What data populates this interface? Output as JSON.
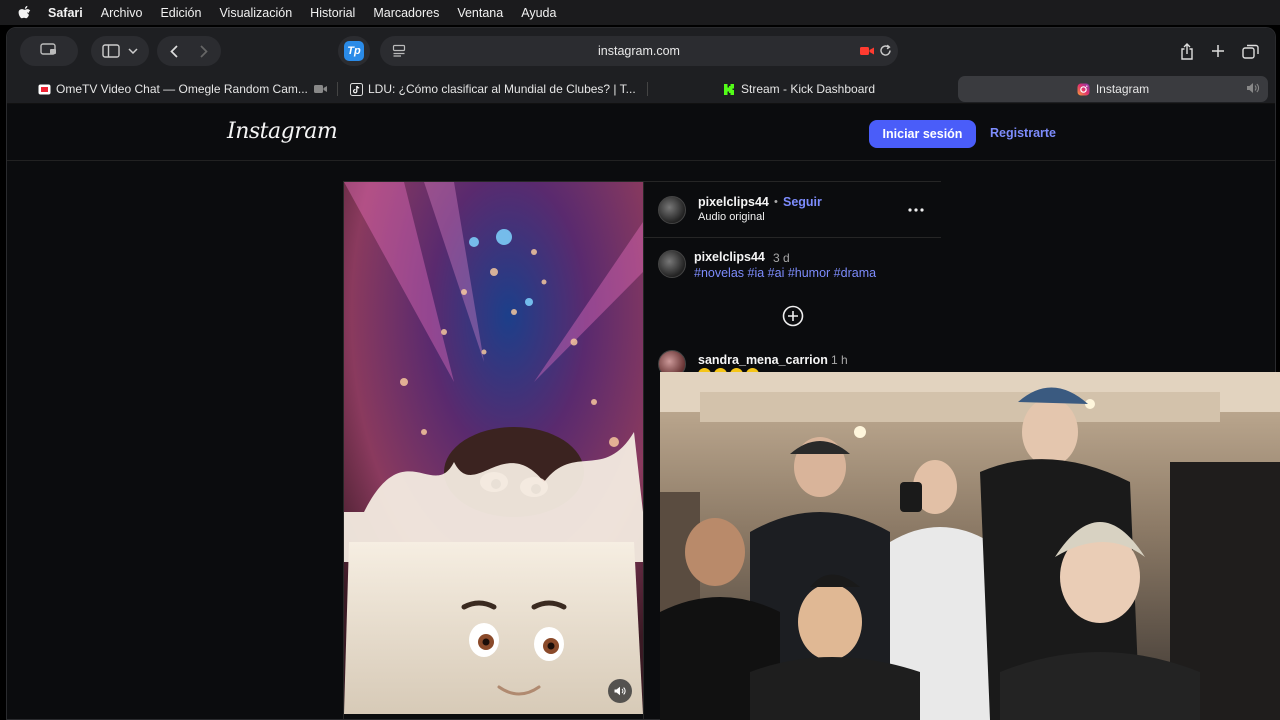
{
  "menubar": {
    "app": "Safari",
    "items": [
      "Archivo",
      "Edición",
      "Visualización",
      "Historial",
      "Marcadores",
      "Ventana",
      "Ayuda"
    ]
  },
  "toolbar": {
    "url": "instagram.com",
    "extension_badge": "Tp"
  },
  "tabs": [
    {
      "label": "OmeTV Video Chat — Omegle Random Cam...",
      "icon": "ometv-favicon"
    },
    {
      "label": "LDU: ¿Cómo clasificar al Mundial de Clubes? | T...",
      "icon": "tiktok-favicon"
    },
    {
      "label": "Stream - Kick Dashboard",
      "icon": "kick-favicon"
    },
    {
      "label": "Instagram",
      "icon": "instagram-favicon"
    }
  ],
  "instagram": {
    "logo": "Instagram",
    "login_label": "Iniciar sesión",
    "signup_label": "Registrarte",
    "post": {
      "author": "pixelclips44",
      "separator": "•",
      "follow_label": "Seguir",
      "audio": "Audio original",
      "caption_author": "pixelclips44",
      "caption_age": "3 d",
      "hashtags": "#novelas #ia #ai #humor #drama",
      "comment_author": "sandra_mena_carrion",
      "comment_age": "1 h"
    }
  },
  "colors": {
    "accent": "#4a5df9",
    "link": "#7d8cfc",
    "background": "#0b0c0e"
  }
}
